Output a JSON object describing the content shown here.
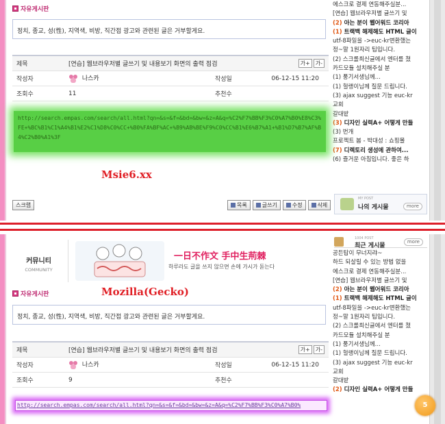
{
  "top_panel": {
    "right_list": [
      {
        "num": "",
        "text": "에스크로 결제 연동해주실분...",
        "bold": false
      },
      {
        "num": "",
        "text": "[연습] 웹브라우저별 글쓰기 및",
        "bold": false
      },
      {
        "num": "(2)",
        "text": "아는 분이 웹어워드 코리아",
        "bold": true
      },
      {
        "num": "(1)",
        "text": "트랙백 해제해도 HTML 글이",
        "bold": true
      },
      {
        "num": "",
        "text": "utf-8파일을 ->euc-kr변환했는",
        "bold": false
      },
      {
        "num": "",
        "text": "정~말 1원자리 팁입니다.",
        "bold": false
      },
      {
        "num": "",
        "text": "(2) 스크롤최신글에서 엔터를 쳤",
        "bold": false
      },
      {
        "num": "",
        "text": "카드모듈 설치해주실 분",
        "bold": false
      },
      {
        "num": "",
        "text": "(1) 풍기서생님께...",
        "bold": false
      },
      {
        "num": "",
        "text": "(1) 헐랭이님께 질문 드립니다.",
        "bold": false
      },
      {
        "num": "",
        "text": "(3) ajax suggest 기능 euc-kr",
        "bold": false
      },
      {
        "num": "",
        "text": "교회",
        "bold": false
      },
      {
        "num": "",
        "text": "갈대밭",
        "bold": false
      },
      {
        "num": "(3)",
        "text": "디자인 실력A+ 어떻게 만들",
        "bold": true
      },
      {
        "num": "",
        "text": "(3) 번개",
        "bold": false
      },
      {
        "num": "",
        "text": "프로젝트 봄 - 박대성 : 쇼핑몰",
        "bold": false
      },
      {
        "num": "(7)",
        "text": "디렉토리 생성에 관하여...",
        "bold": true
      },
      {
        "num": "",
        "text": "(6) 즐거운 아침입니다. 좋은 하",
        "bold": false
      }
    ],
    "section_title": "자유게시판",
    "notice": "정치, 종교, 성(性), 지역색, 비방, 직간접 광고와 관련된 글은 거부할게요.",
    "labels": {
      "subject": "제목",
      "author": "작성자",
      "date_label": "작성일",
      "views": "조회수",
      "recommend": "추천수"
    },
    "subject": "[연습] 웹브라우저별 글쓰기 및 내용보기 화면의 출력 점검",
    "font_plus": "가+",
    "font_minus": "가-",
    "author": "나스카",
    "date": "06-12-15 11:20",
    "views": "11",
    "link": "http://search.empas.com/search/all.html?qn=&s=&f=&bd=&bw=&z=A&q=%C2%F7%BB%F3%C0%A7%B0%E8%C3%FE+%BC%B1%C1%A4%B1%E2%C1%D8%C0%CC+%B0%FA%BF%AC+%B9%AB%BE%F9%C0%CC%B1%E6%B7%A1+%B1%D7%B7%AF%B4%C2%B0%A1%3F",
    "caption": "Msie6.xx",
    "buttons": {
      "scrap": "스크랩",
      "list": "목록",
      "write": "글쓰기",
      "edit": "수정",
      "delete": "삭제"
    },
    "mypost_small": "MY POST",
    "mypost_label": "나의 게시물",
    "more": "more"
  },
  "bottom_panel": {
    "banner": {
      "community_ko": "커뮤니티",
      "community_en": "COMMUNITY",
      "slogan": "一日不作文 手中生荊棘",
      "slogan_sub": "하루라도 글을 쓰지 않으면 손에 가시가 돋는다"
    },
    "recent_small": "1004 POST",
    "recent_label": "최근 게시물",
    "more": "more",
    "right_list": [
      {
        "num": "",
        "text": "공든탑이 무너지랴~",
        "bold": false
      },
      {
        "num": "",
        "text": "하드 되살릴 수 있는 방법 없을",
        "bold": false
      },
      {
        "num": "",
        "text": "에스크로 결제 연동해주실분...",
        "bold": false
      },
      {
        "num": "",
        "text": "[연습] 웹브라우저별 글쓰기 및",
        "bold": false
      },
      {
        "num": "(2)",
        "text": "아는 분이 웹어워드 코리아",
        "bold": true
      },
      {
        "num": "(1)",
        "text": "트랙백 해제해도 HTML 글이",
        "bold": true
      },
      {
        "num": "",
        "text": "utf-8파일을 ->euc-kr변환했는",
        "bold": false
      },
      {
        "num": "",
        "text": "정~말 1원자리 팁입니다.",
        "bold": false
      },
      {
        "num": "",
        "text": "(2) 스크롤최신글에서 엔터를 쳤",
        "bold": false
      },
      {
        "num": "",
        "text": "카드모듈 설치해주실 분",
        "bold": false
      },
      {
        "num": "",
        "text": "(1) 풍기서생님께...",
        "bold": false
      },
      {
        "num": "",
        "text": "(1) 헐랭이님께 질문 드립니다.",
        "bold": false
      },
      {
        "num": "",
        "text": "(3) ajax suggest 기능 euc-kr",
        "bold": false
      },
      {
        "num": "",
        "text": "교회",
        "bold": false
      },
      {
        "num": "",
        "text": "갈대밭",
        "bold": false
      },
      {
        "num": "(2)",
        "text": "디자인 실력A+ 어떻게 만들",
        "bold": true
      }
    ],
    "section_title": "자유게시판",
    "caption": "Mozilla(Gecko)",
    "notice": "정치, 종교, 성(性), 지역색, 비방, 직간접 광고와 관련된 글은 거부할게요.",
    "labels": {
      "subject": "제목",
      "author": "작성자",
      "date_label": "작성일",
      "views": "조회수",
      "recommend": "추천수"
    },
    "subject": "[연습] 웹브라우저별 글쓰기 및 내용보기 화면의 출력 점검",
    "font_plus": "가+",
    "font_minus": "가-",
    "author": "나스카",
    "date": "06-12-15 11:20",
    "views": "9",
    "link": "http://search.empas.com/search/all.html?qn=&s=&f=&bd=&bw=&z=A&q=%C2%F7%BB%F3%C0%A7%B0%",
    "orange_label": "5"
  },
  "colors": {
    "accent_pink": "#d63a82",
    "divider_red": "#dd1f2a",
    "caption_red": "#e01e24",
    "glow_green": "#58cf45",
    "glow_purple": "#d96bf5"
  },
  "icons": [
    "board-square-icon",
    "avatar-icon",
    "list-icon",
    "write-icon",
    "edit-icon",
    "delete-icon",
    "mypost-icon",
    "recent-icon"
  ]
}
